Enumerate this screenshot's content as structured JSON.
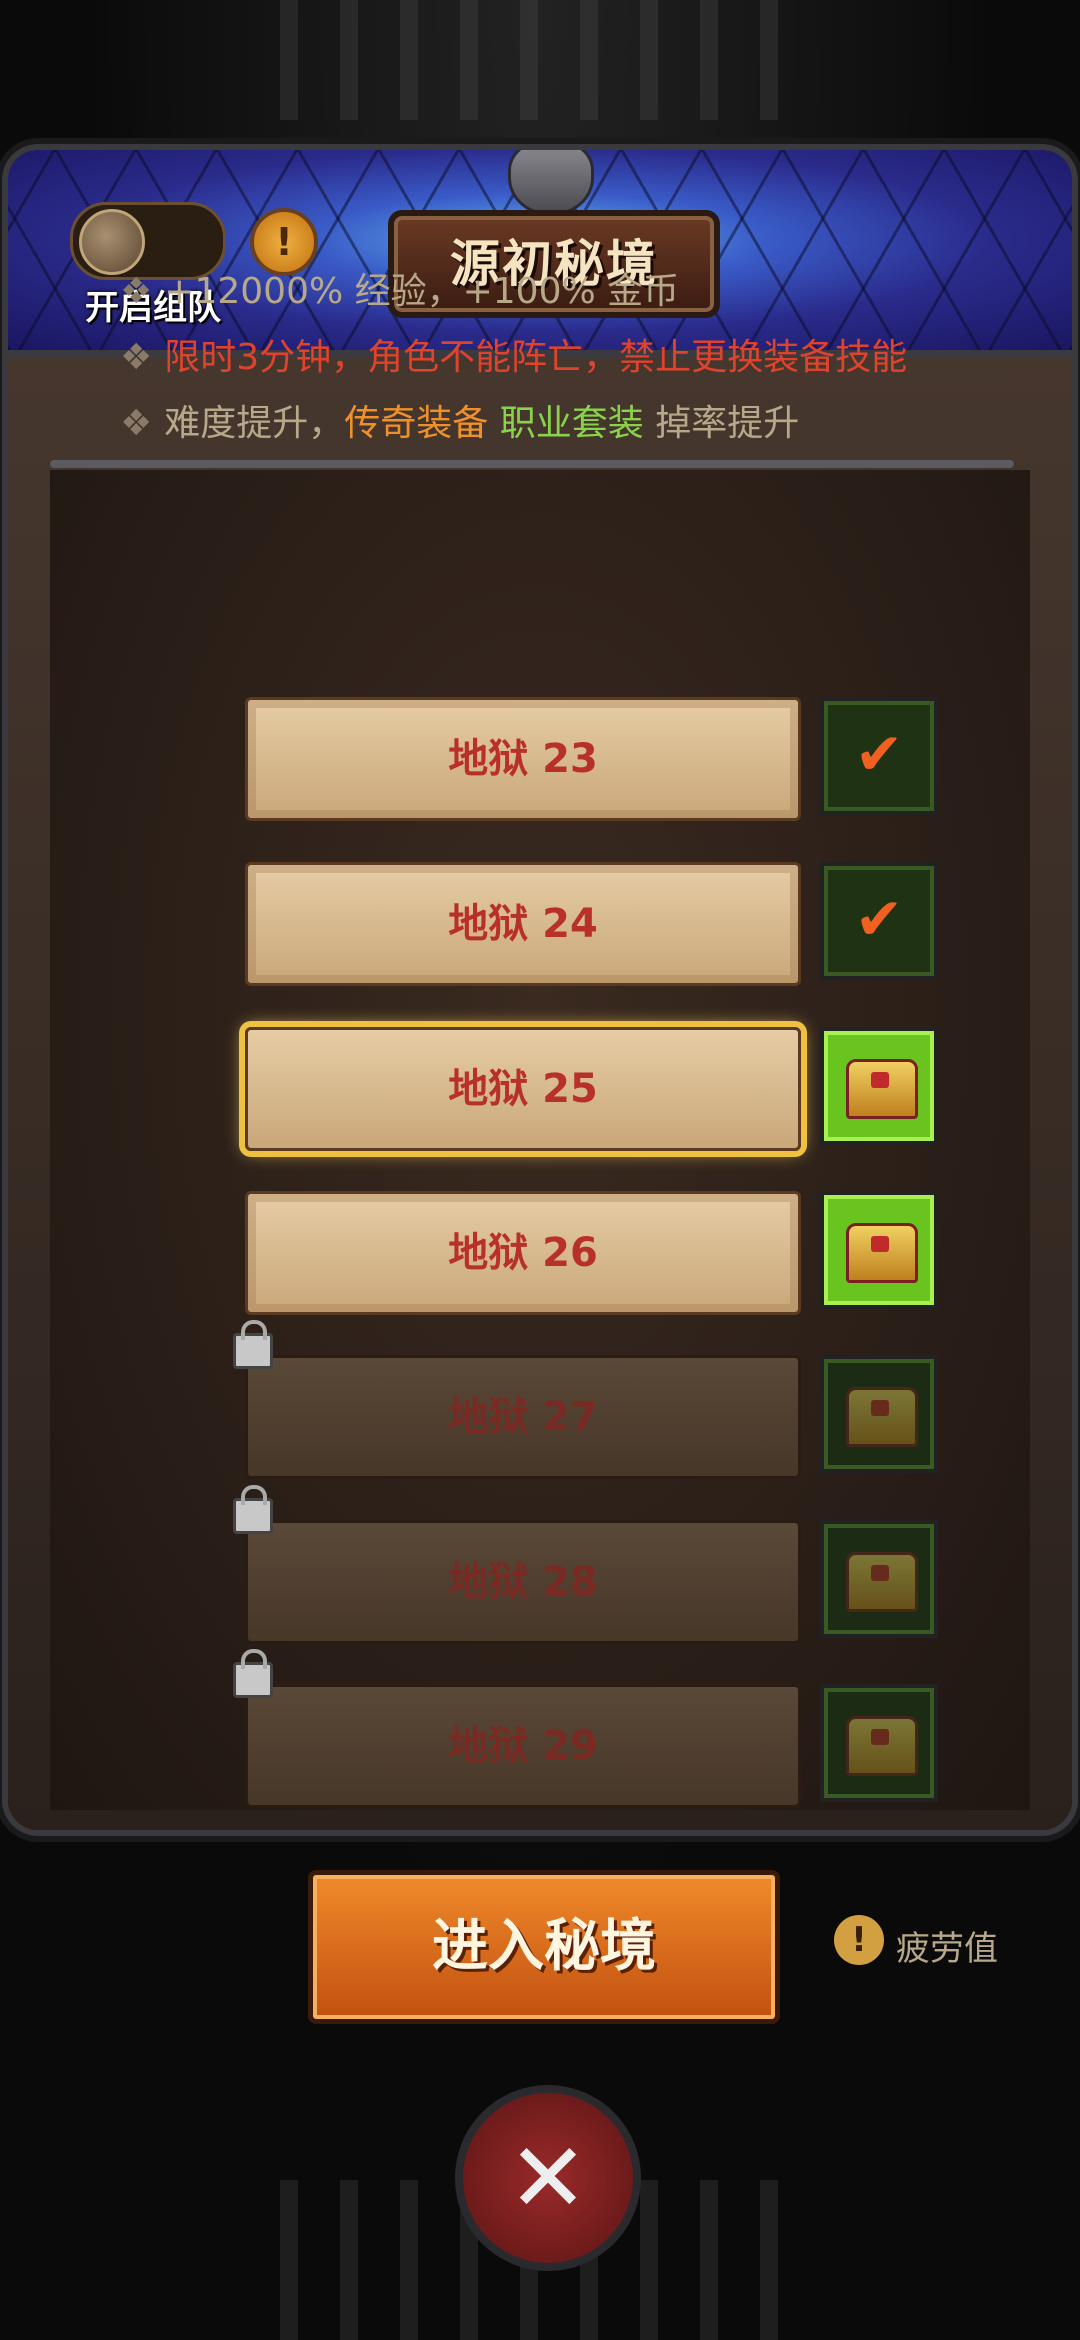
{
  "header": {
    "title": "源初秘境",
    "team_toggle_label": "开启组队",
    "info_icon": "exclamation-icon"
  },
  "description": {
    "line1": "+12000% 经验，+100% 金币",
    "line2": "限时3分钟，角色不能阵亡，禁止更换装备技能",
    "line3_prefix": "难度提升，",
    "line3_orange": "传奇装备",
    "line3_green": "职业套装",
    "line3_suffix": "掉率提升"
  },
  "levels": [
    {
      "label": "地狱 23",
      "status": "completed",
      "icon": "check-icon"
    },
    {
      "label": "地狱 24",
      "status": "completed",
      "icon": "check-icon"
    },
    {
      "label": "地狱 25",
      "status": "selected",
      "icon": "chest-icon"
    },
    {
      "label": "地狱 26",
      "status": "available",
      "icon": "chest-icon"
    },
    {
      "label": "地狱 27",
      "status": "locked",
      "icon": "chest-icon"
    },
    {
      "label": "地狱 28",
      "status": "locked",
      "icon": "chest-icon"
    },
    {
      "label": "地狱 29",
      "status": "locked",
      "icon": "chest-icon"
    }
  ],
  "footer": {
    "enter_button": "进入秘境",
    "fatigue_label": "疲劳值",
    "fatigue_icon": "exclamation-icon",
    "close_icon": "close-icon"
  },
  "colors": {
    "accent_red": "#e0432c",
    "accent_orange": "#f0902a",
    "accent_green": "#8ad24a",
    "button": "#e07422"
  }
}
